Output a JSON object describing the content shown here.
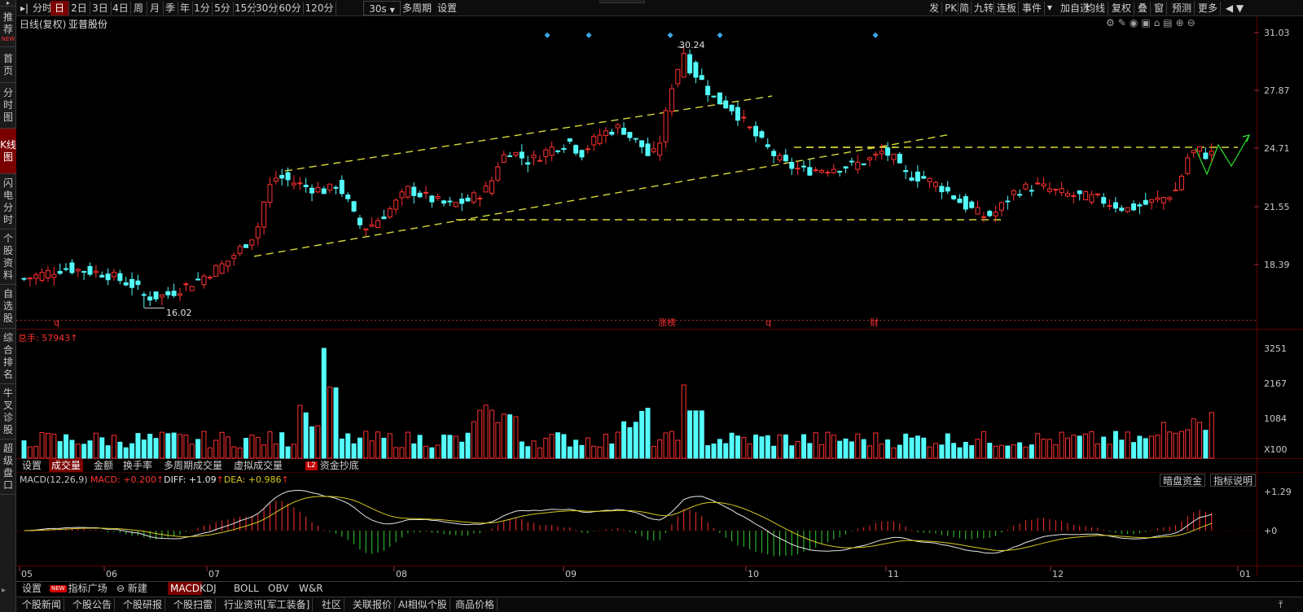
{
  "left_nav": [
    {
      "label": "推荐",
      "badge": "NEW"
    },
    {
      "label": "首页"
    },
    {
      "label": "分时图"
    },
    {
      "label": "K线图",
      "active": true
    },
    {
      "label": "闪电分时"
    },
    {
      "label": "个股资料"
    },
    {
      "label": "自选股"
    },
    {
      "label": "综合排名"
    },
    {
      "label": "牛叉诊股"
    },
    {
      "label": "超级盘口"
    }
  ],
  "toolbar": {
    "periods": [
      "分时",
      "日",
      "2日",
      "3日",
      "4日",
      "周",
      "月",
      "季",
      "年",
      "1分",
      "5分",
      "15分",
      "30分",
      "60分",
      "120分"
    ],
    "selected_period": "日",
    "custom_period": "30s",
    "multi_period": "多周期",
    "settings": "设置",
    "right_items": [
      "发",
      "PK",
      "简",
      "九转",
      "连板",
      "事件",
      "加自选",
      "均线",
      "复权",
      "叠",
      "窗",
      "预测",
      "更多"
    ]
  },
  "chart": {
    "title": "日线(复权)",
    "stock_name": "亚普股份",
    "price_axis": [
      "31.03",
      "27.87",
      "24.71",
      "21.55",
      "18.39"
    ],
    "high_label": "30.24",
    "low_label": "16.02",
    "event_markers": [
      {
        "label": "q",
        "color": "#ff3030"
      },
      {
        "label": "涨榜",
        "color": "#ff3030"
      },
      {
        "label": "q",
        "color": "#ff3030"
      },
      {
        "label": "财",
        "color": "#ff3030"
      }
    ]
  },
  "volume": {
    "label": "总手",
    "value": "57943",
    "axis": [
      "3251",
      "2167",
      "1084",
      "X100"
    ]
  },
  "volume_tabs": [
    "设置",
    "成交量",
    "金额",
    "换手率",
    "多周期成交量",
    "虚拟成交量",
    "资金抄底"
  ],
  "volume_tab_selected": "成交量",
  "l2_tag": "L2",
  "macd": {
    "params": "MACD(12,26,9)",
    "macd_label": "MACD: ",
    "macd_value": "+0.200",
    "diff_label": "DIFF: ",
    "diff_value": "+1.09",
    "dea_label": "DEA: ",
    "dea_value": "+0.986",
    "axis": [
      "+1.29",
      "+0"
    ],
    "buttons": [
      "暗盘资金",
      "指标说明"
    ]
  },
  "x_axis": [
    "05",
    "06",
    "07",
    "08",
    "09",
    "10",
    "11",
    "12",
    "01"
  ],
  "indicator_tabs": [
    "设置",
    "指标广场",
    "新建",
    "MACD",
    "KDJ",
    "BOLL",
    "OBV",
    "W&R"
  ],
  "indicator_new_tag": "NEW",
  "indicator_selected": "MACD",
  "bottom_tabs": [
    "个股新闻",
    "个股公告",
    "个股研报",
    "个股扫雷",
    "行业资讯[军工装备]",
    "社区",
    "关联报价",
    "AI相似个股",
    "商品价格"
  ],
  "colors": {
    "up": "#ff3030",
    "down": "#54fcfc",
    "trend_line": "#d8d83a",
    "diff_line": "#e6e6e6",
    "dea_line": "#d8c820",
    "marker": "#3aa8e8"
  }
}
